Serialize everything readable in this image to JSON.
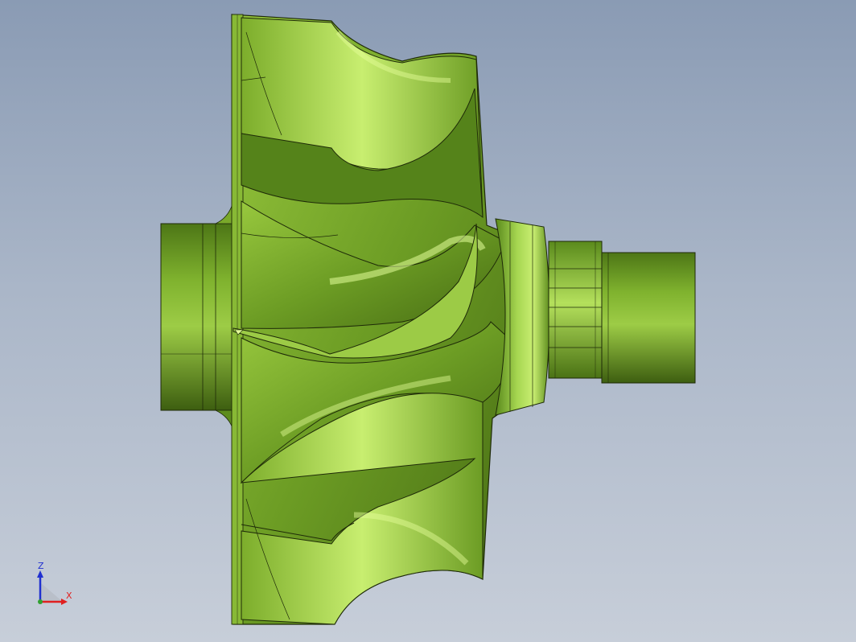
{
  "viewport": {
    "background_top": "#8a9bb4",
    "background_bottom": "#c7ced9"
  },
  "model": {
    "name": "impeller",
    "color": "#6a9a23",
    "highlight": "#c6ec6a",
    "shadow": "#3f6012",
    "edge_color": "#1e2a08"
  },
  "triad": {
    "z_label": "Z",
    "x_label": "X",
    "z_color": "#2030d0",
    "x_color": "#e02020"
  }
}
